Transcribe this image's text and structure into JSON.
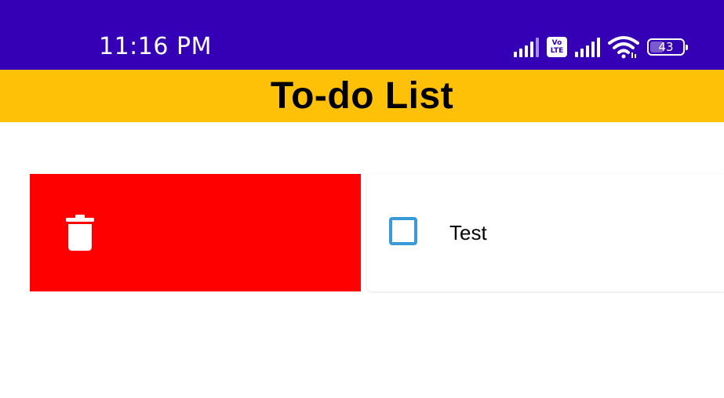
{
  "status_bar": {
    "time": "11:16 PM",
    "volte_top": "Vo",
    "volte_bottom": "LTE",
    "battery": "43",
    "battery_level": 0.43,
    "background_color": "#3500b5"
  },
  "app_bar": {
    "title": "To-do List",
    "background_color": "#fec107"
  },
  "todo_items": [
    {
      "text": "Test",
      "checked": false,
      "swipe_action": "delete",
      "swipe_color": "#ff0000",
      "action_icon": "trash-icon"
    }
  ],
  "checkbox_color": "#3a9ad9"
}
